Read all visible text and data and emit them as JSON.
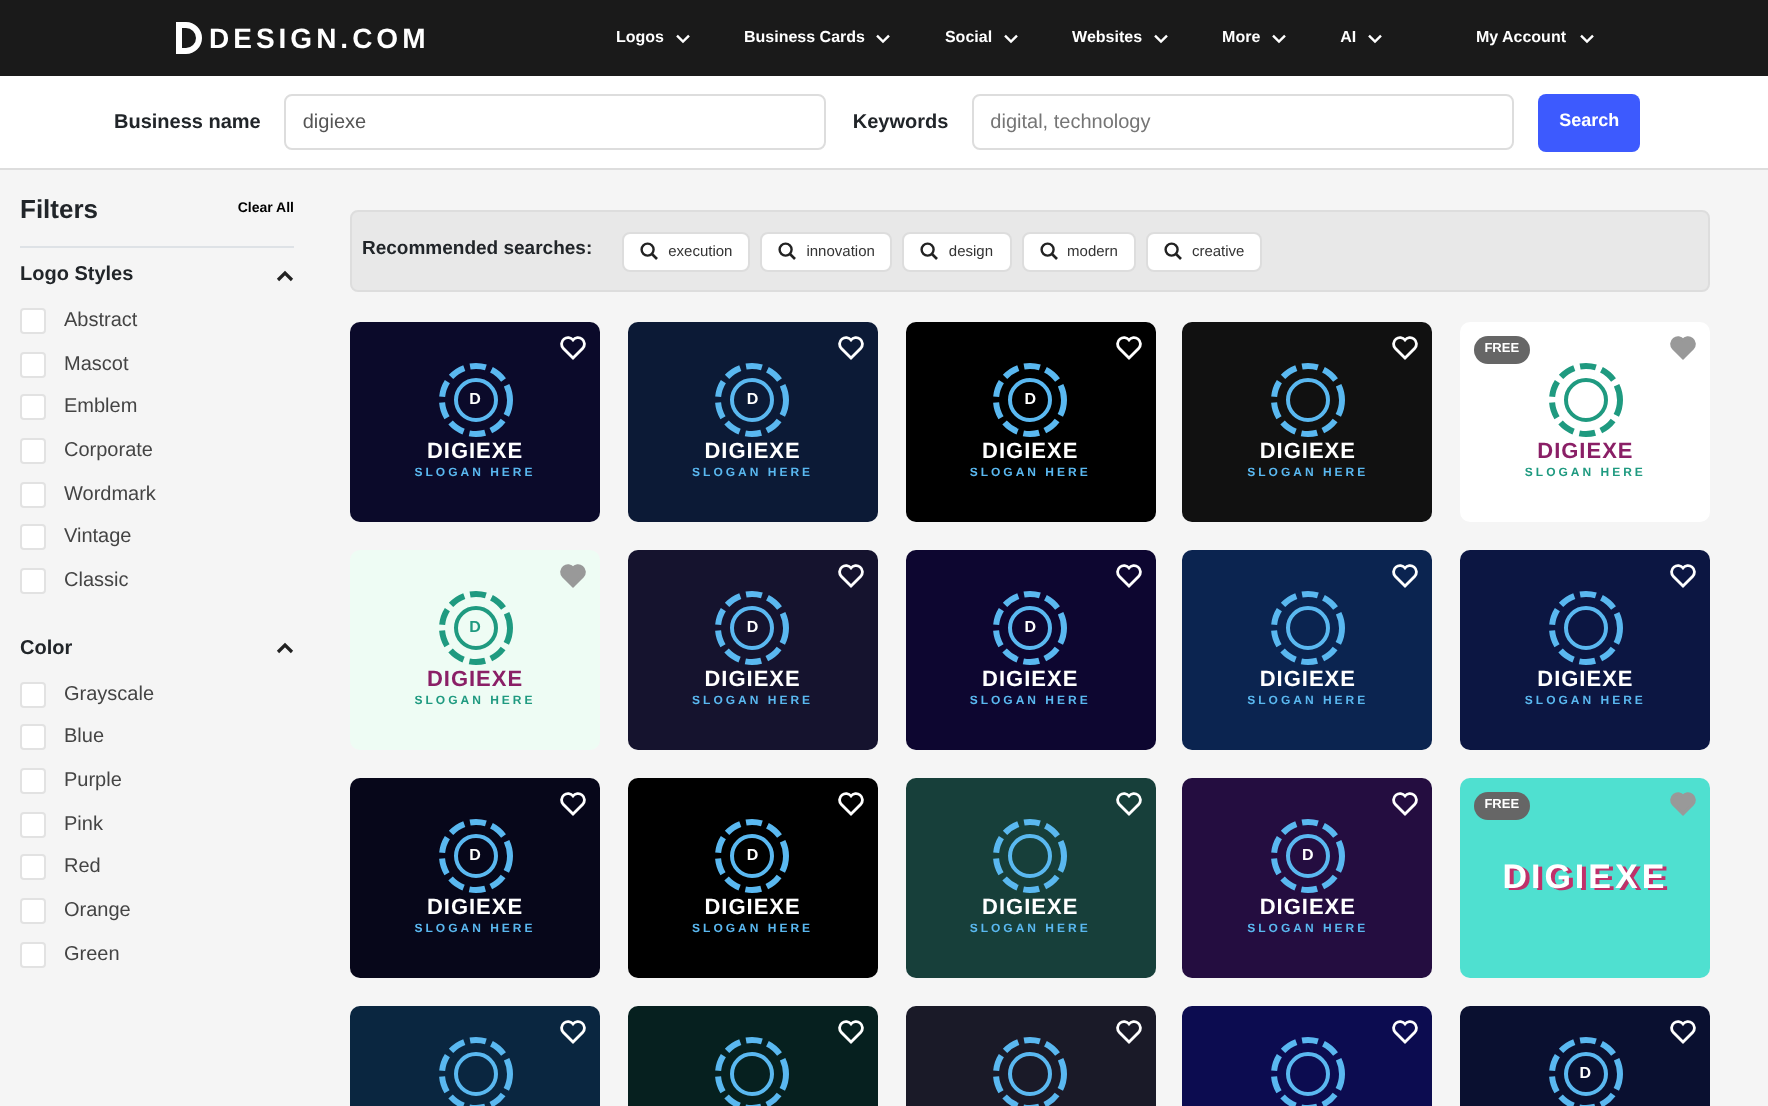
{
  "navbar": {
    "brand": "DESIGN.COM",
    "menu": [
      "Logos",
      "Business Cards",
      "Social",
      "Websites",
      "More",
      "AI"
    ],
    "account": "My Account"
  },
  "search": {
    "business_label": "Business name",
    "business_value": "digiexe",
    "keywords_label": "Keywords",
    "keywords_placeholder": "digital, technology",
    "button": "Search"
  },
  "filters": {
    "title": "Filters",
    "clear": "Clear All",
    "groups": [
      {
        "title": "Logo Styles",
        "expanded": true,
        "options": [
          {
            "label": "Abstract",
            "checked": false
          },
          {
            "label": "Mascot",
            "checked": false
          },
          {
            "label": "Emblem",
            "checked": false
          },
          {
            "label": "Corporate",
            "checked": false
          },
          {
            "label": "Wordmark",
            "checked": false
          },
          {
            "label": "Vintage",
            "checked": false
          },
          {
            "label": "Classic",
            "checked": false
          }
        ]
      },
      {
        "title": "Color",
        "expanded": true,
        "options": [
          {
            "label": "Grayscale",
            "checked": false
          },
          {
            "label": "Blue",
            "checked": false
          },
          {
            "label": "Purple",
            "checked": false
          },
          {
            "label": "Pink",
            "checked": false
          },
          {
            "label": "Red",
            "checked": false
          },
          {
            "label": "Orange",
            "checked": false
          },
          {
            "label": "Green",
            "checked": false
          }
        ]
      }
    ]
  },
  "recommended": {
    "label": "Recommended searches:",
    "chips": [
      "execution",
      "innovation",
      "design",
      "modern",
      "creative"
    ]
  },
  "logos": [
    {
      "color": "#0b0a2a",
      "mark": "D",
      "name": "DIGIEXE",
      "slogan": "SLOGAN HERE"
    },
    {
      "color": "#0c1a36",
      "mark": "D",
      "name": "DIGIEXE",
      "slogan": "SLOGAN HERE"
    },
    {
      "color": "#000000",
      "mark": "D",
      "name": "DIGIEXE",
      "slogan": "SLOGAN HERE"
    },
    {
      "color": "#111111",
      "name": "DIGIEXE",
      "slogan": "SLOGAN HERE"
    },
    {
      "color": "#ffffff",
      "badge": "FREE",
      "name": "DIGIEXE",
      "slogan": "SLOGAN HERE"
    },
    {
      "color": "#eefcf4",
      "mark": "D",
      "name": "DIGIEXE",
      "slogan": "SLOGAN HERE"
    },
    {
      "color": "#15132e",
      "mark": "D",
      "name": "DIGIEXE",
      "slogan": "SLOGAN HERE"
    },
    {
      "color": "#0d0630",
      "mark": "D",
      "name": "DIGIEXE",
      "slogan": "SLOGAN HERE"
    },
    {
      "color": "#0b2450",
      "name": "DIGIEXE",
      "slogan": "SLOGAN HERE"
    },
    {
      "color": "#0c1642",
      "name": "DIGIEXE",
      "slogan": "SLOGAN HERE"
    },
    {
      "color": "#07071a",
      "mark": "D",
      "name": "DIGIEXE",
      "slogan": "SLOGAN HERE"
    },
    {
      "color": "#000000",
      "mark": "D",
      "name": "DIGIEXE",
      "slogan": "SLOGAN HERE"
    },
    {
      "color": "#173f3a",
      "name": "DIGIEXE",
      "slogan": "SLOGAN HERE"
    },
    {
      "color": "#240d40",
      "mark": "D",
      "name": "DIGIEXE",
      "slogan": "SLOGAN HERE"
    },
    {
      "color": "#4fe0d0",
      "badge": "FREE",
      "name": "DIGIEXE"
    },
    {
      "color": "#0a2640"
    },
    {
      "color": "#06201f"
    },
    {
      "color": "#1a1a28"
    },
    {
      "color": "#0c0c50"
    },
    {
      "color": "#0a1030",
      "mark": "D"
    }
  ]
}
